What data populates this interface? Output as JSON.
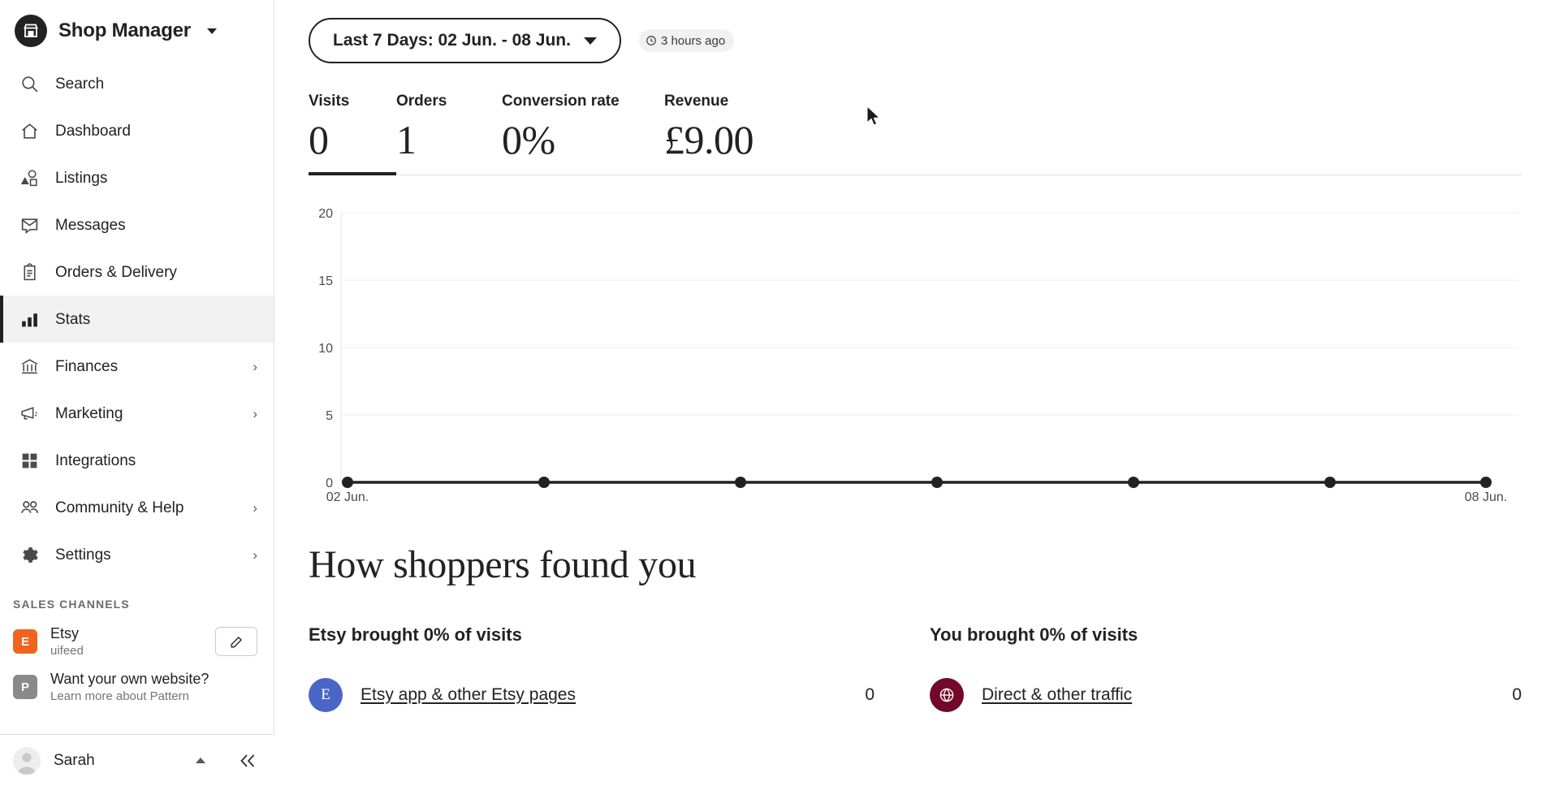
{
  "brand": {
    "title": "Shop Manager",
    "logo_icon": "shop-icon",
    "caret_icon": "chevron-down-icon"
  },
  "sidebar": {
    "items": [
      {
        "label": "Search",
        "icon": "search-icon",
        "active": false,
        "has_chevron": false
      },
      {
        "label": "Dashboard",
        "icon": "home-icon",
        "active": false,
        "has_chevron": false
      },
      {
        "label": "Listings",
        "icon": "shapes-icon",
        "active": false,
        "has_chevron": false
      },
      {
        "label": "Messages",
        "icon": "envelope-icon",
        "active": false,
        "has_chevron": false
      },
      {
        "label": "Orders & Delivery",
        "icon": "clipboard-icon",
        "active": false,
        "has_chevron": false
      },
      {
        "label": "Stats",
        "icon": "bar-chart-icon",
        "active": true,
        "has_chevron": false
      },
      {
        "label": "Finances",
        "icon": "bank-icon",
        "active": false,
        "has_chevron": true
      },
      {
        "label": "Marketing",
        "icon": "megaphone-icon",
        "active": false,
        "has_chevron": true
      },
      {
        "label": "Integrations",
        "icon": "grid-icon",
        "active": false,
        "has_chevron": false
      },
      {
        "label": "Community & Help",
        "icon": "people-icon",
        "active": false,
        "has_chevron": true
      },
      {
        "label": "Settings",
        "icon": "gear-icon",
        "active": false,
        "has_chevron": true
      }
    ],
    "sales_channels_label": "SALES CHANNELS",
    "channels": [
      {
        "badge": "E",
        "badge_color": "#f1641e",
        "name": "Etsy",
        "sub": "uifeed",
        "has_edit": true,
        "edit_icon": "pencil-icon"
      },
      {
        "badge": "P",
        "badge_color": "#8a8a8a",
        "name": "Want your own website?",
        "sub": "Learn more about Pattern",
        "has_edit": false,
        "edit_icon": ""
      }
    ],
    "user": {
      "name": "Sarah",
      "avatar_icon": "avatar-icon",
      "caret_icon": "chevron-up-icon"
    },
    "collapse_icon": "collapse-left-icon"
  },
  "toolbar": {
    "date_range_label": "Last 7 Days: 02 Jun. - 08 Jun.",
    "date_range_caret": "chevron-down-icon",
    "updated_icon": "clock-icon",
    "updated_text": "3 hours ago"
  },
  "metrics": [
    {
      "title": "Visits",
      "value": "0",
      "selected": true
    },
    {
      "title": "Orders",
      "value": "1",
      "selected": false
    },
    {
      "title": "Conversion rate",
      "value": "0%",
      "selected": false
    },
    {
      "title": "Revenue",
      "value": "£9.00",
      "selected": false
    }
  ],
  "chart_data": {
    "type": "line",
    "title": "",
    "xlabel": "",
    "ylabel": "",
    "x": [
      "02 Jun.",
      "03 Jun.",
      "04 Jun.",
      "05 Jun.",
      "06 Jun.",
      "07 Jun.",
      "08 Jun."
    ],
    "tick_labels_shown": [
      "02 Jun.",
      "08 Jun."
    ],
    "series": [
      {
        "name": "Visits",
        "values": [
          0,
          0,
          0,
          0,
          0,
          0,
          0
        ],
        "color": "#222222"
      }
    ],
    "y_ticks": [
      0,
      5,
      10,
      15,
      20
    ],
    "ylim": [
      0,
      20
    ],
    "grid": true,
    "legend": "none",
    "marker": "circle"
  },
  "found_section": {
    "title": "How shoppers found you",
    "columns": [
      {
        "heading": "Etsy brought 0% of visits",
        "rows": [
          {
            "icon_letter": "E",
            "icon_color": "#4a66c4",
            "icon_name": "etsy-source-icon",
            "label": "Etsy app & other Etsy pages",
            "count": "0"
          }
        ]
      },
      {
        "heading": "You brought 0% of visits",
        "rows": [
          {
            "icon_letter": "ⓘ",
            "icon_color": "#72092a",
            "icon_name": "globe-icon",
            "label": "Direct & other traffic",
            "count": "0"
          }
        ]
      }
    ]
  }
}
